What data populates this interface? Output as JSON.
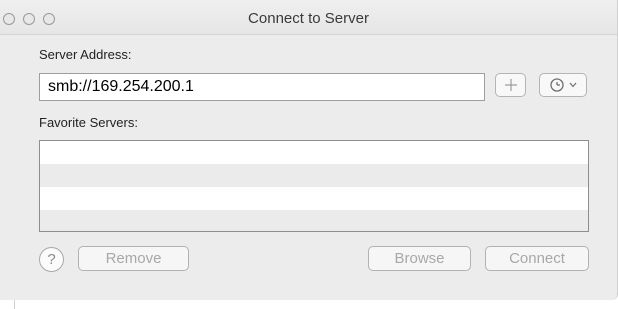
{
  "window": {
    "title": "Connect to Server"
  },
  "server_address": {
    "label": "Server Address:",
    "value": "smb://169.254.200.1"
  },
  "favorites": {
    "label": "Favorite Servers:",
    "items": []
  },
  "toolbar_icons": {
    "add": "plus-icon",
    "recent": "clock-icon",
    "dropdown": "chevron-down-icon"
  },
  "buttons": {
    "help": "?",
    "remove": "Remove",
    "browse": "Browse",
    "connect": "Connect"
  },
  "colors": {
    "window_bg": "#ececec",
    "disabled_text": "#a8a8a8"
  }
}
